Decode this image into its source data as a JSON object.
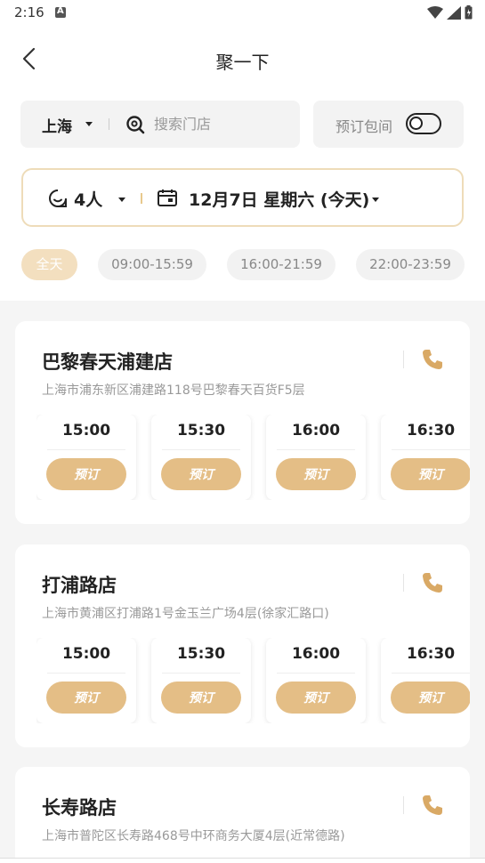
{
  "status_bar": {
    "time": "2:16"
  },
  "nav": {
    "title": "聚一下"
  },
  "search": {
    "city": "上海",
    "placeholder": "搜索门店"
  },
  "private_room": {
    "label": "预订包间",
    "enabled": false
  },
  "filter": {
    "people": "4人",
    "date": "12月7日 星期六 (今天)"
  },
  "time_chips": [
    {
      "label": "全天",
      "active": true
    },
    {
      "label": "09:00-15:59",
      "active": false
    },
    {
      "label": "16:00-21:59",
      "active": false
    },
    {
      "label": "22:00-23:59",
      "active": false
    }
  ],
  "book_label": "预订",
  "stores": [
    {
      "name": "巴黎春天浦建店",
      "address": "上海市浦东新区浦建路118号巴黎春天百货F5层",
      "slots": [
        "15:00",
        "15:30",
        "16:00",
        "16:30"
      ]
    },
    {
      "name": "打浦路店",
      "address": "上海市黄浦区打浦路1号金玉兰广场4层(徐家汇路口)",
      "slots": [
        "15:00",
        "15:30",
        "16:00",
        "16:30"
      ]
    },
    {
      "name": "长寿路店",
      "address": "上海市普陀区长寿路468号中环商务大厦4层(近常德路)",
      "slots": []
    }
  ],
  "colors": {
    "accent": "#e4be86",
    "accent_light": "#f3dfbf",
    "border": "#eedcb9",
    "phone": "#d9a965"
  }
}
